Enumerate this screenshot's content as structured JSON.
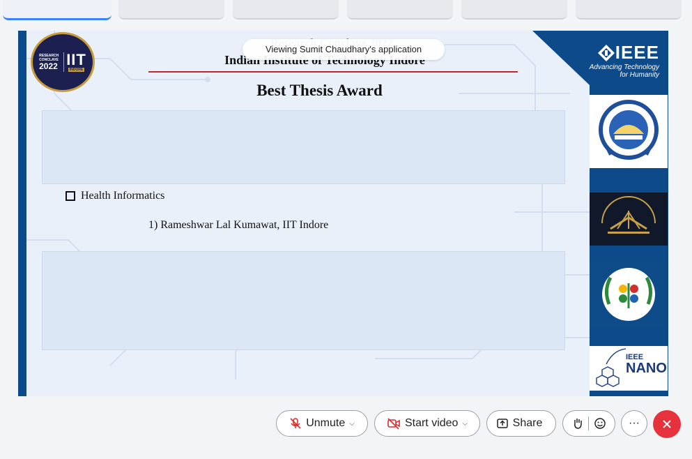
{
  "tabs": [
    {
      "active": true
    },
    {
      "active": false
    },
    {
      "active": false
    },
    {
      "active": false
    },
    {
      "active": false
    },
    {
      "active": false
    }
  ],
  "slide": {
    "logo_top_text": "RESEARCH",
    "logo_mid_text": "CONCLAVE",
    "logo_year": "2022",
    "logo_iit": "IIT",
    "logo_indore": "INDORE",
    "conclave_title": "Research Conclave 2022",
    "institute": "Indian Institute of Technology Indore",
    "award_title": "Best Thesis Award",
    "category": "Health Informatics",
    "winner": "1) Rameshwar Lal Kumawat, IIT Indore",
    "ieee_name": "IEEE",
    "ieee_tagline_1": "Advancing Technology",
    "ieee_tagline_2": "for Humanity",
    "nano_small": "IEEE",
    "nano_big": "NANO"
  },
  "banner": {
    "viewing": "Viewing Sumit Chaudhary's application"
  },
  "toolbar": {
    "unmute": "Unmute",
    "start_video": "Start video",
    "share": "Share",
    "more": "···"
  },
  "colors": {
    "end_call": "#e5323c",
    "slide_blue": "#0b4a8b",
    "accent_red": "#c0262b"
  }
}
